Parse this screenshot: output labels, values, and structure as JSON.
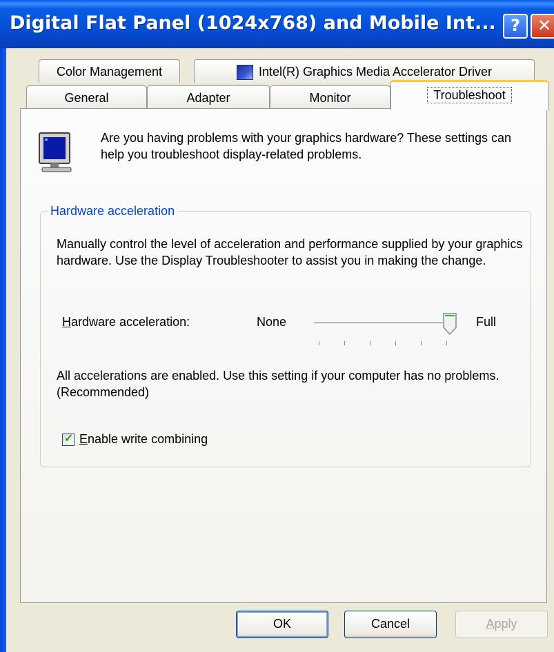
{
  "window": {
    "title": "Digital Flat Panel (1024x768) and Mobile Int...",
    "help_label": "?",
    "close_label": "✕"
  },
  "tabs": {
    "row_top": [
      {
        "label": "Color Management"
      },
      {
        "label": "Intel(R) Graphics Media Accelerator Driver",
        "icon": "intel-graphics-icon"
      }
    ],
    "row_bottom": [
      {
        "label": "General"
      },
      {
        "label": "Adapter"
      },
      {
        "label": "Monitor"
      },
      {
        "label": "Troubleshoot",
        "active": true
      }
    ]
  },
  "troubleshoot": {
    "intro_text": "Are you having problems with your graphics hardware? These settings can help you troubleshoot display-related problems.",
    "group_title": "Hardware acceleration",
    "description": " Manually control the level of acceleration and performance supplied by your graphics hardware. Use the Display Troubleshooter to assist you in making the change.",
    "slider": {
      "label_rest": "ardware acceleration:",
      "label_accel": "H",
      "min_label": "None",
      "max_label": "Full",
      "level": 6,
      "max_level": 6
    },
    "status_text": "All accelerations are enabled. Use this setting if your computer has no problems. (Recommended)",
    "write_combining": {
      "checked": true,
      "label_accel": "E",
      "label_rest": "nable write combining"
    }
  },
  "buttons": {
    "ok": "OK",
    "cancel": "Cancel",
    "apply_accel": "A",
    "apply_rest": "pply"
  },
  "colors": {
    "title_bar": "#0553d9",
    "group_title": "#0046d5",
    "active_tab_accent": "#ffc73c",
    "checkmark": "#21a121"
  }
}
